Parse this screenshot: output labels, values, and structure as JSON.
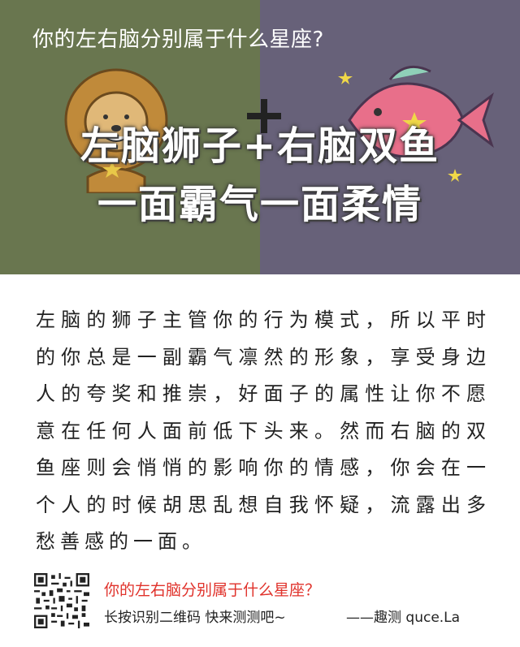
{
  "hero": {
    "question": "你的左右脑分别属于什么星座?",
    "headline_line1": "左脑狮子+右脑双鱼",
    "headline_line2": "一面霸气一面柔情",
    "left_bg": "#69764f",
    "right_bg": "#676179",
    "left_illustration": "lion-icon",
    "right_illustration": "fish-icon"
  },
  "body": {
    "paragraph": "左脑的狮子主管你的行为模式，所以平时的你总是一副霸气凛然的形象，享受身边人的夸奖和推崇，好面子的属性让你不愿意在任何人面前低下头来。然而右脑的双鱼座则会悄悄的影响你的情感，你会在一个人的时候胡思乱想自我怀疑，流露出多愁善感的一面。"
  },
  "footer": {
    "question": "你的左右脑分别属于什么星座？",
    "hint": "长按识别二维码  快来测测吧~",
    "brand": "——趣测 quce.La",
    "accent_color": "#e0322b"
  }
}
